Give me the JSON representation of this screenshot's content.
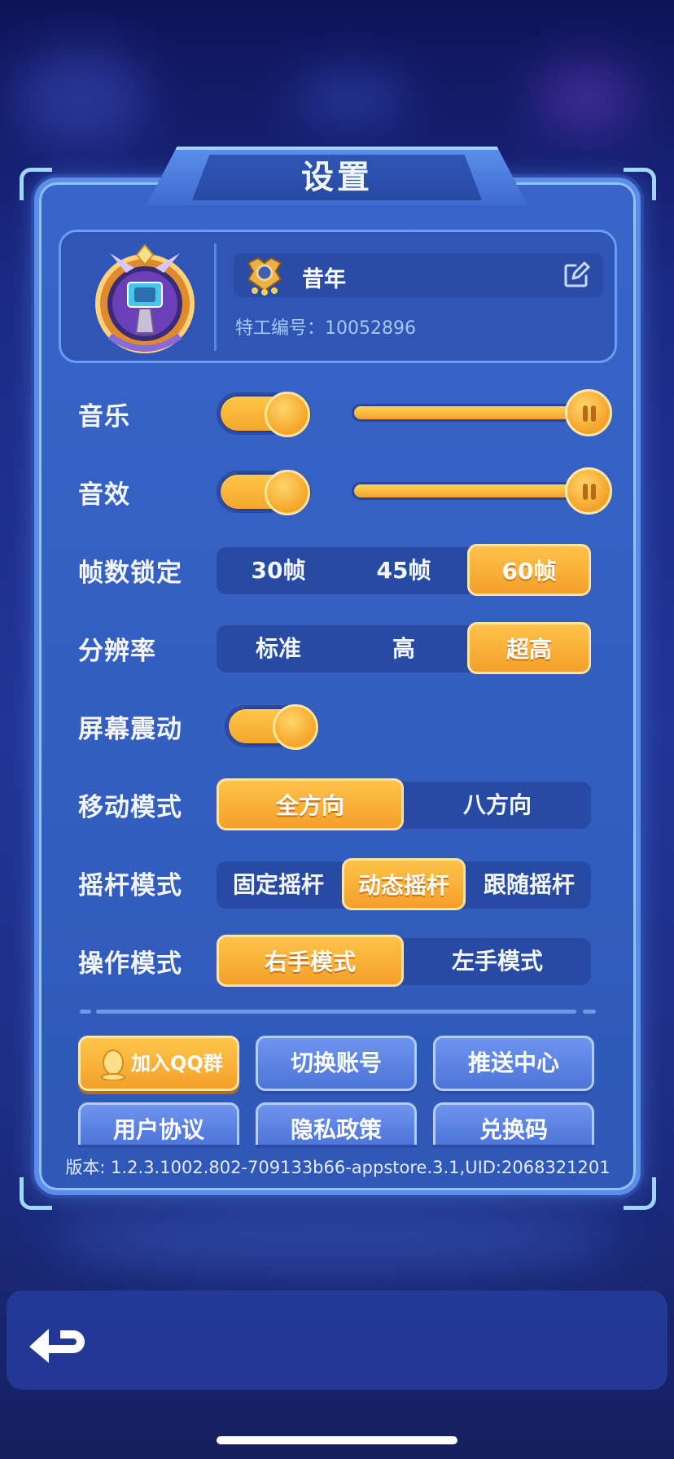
{
  "title": "设置",
  "profile": {
    "player_name": "昔年",
    "agent_id_label": "特工编号：",
    "agent_id": "10052896"
  },
  "settings": {
    "music": {
      "label": "音乐",
      "enabled": true,
      "volume": 1.0
    },
    "sfx": {
      "label": "音效",
      "enabled": true,
      "volume": 1.0
    },
    "fps_lock": {
      "label": "帧数锁定",
      "options": [
        "30帧",
        "45帧",
        "60帧"
      ],
      "selected": "60帧"
    },
    "resolution": {
      "label": "分辨率",
      "options": [
        "标准",
        "高",
        "超高"
      ],
      "selected": "超高"
    },
    "screen_shake": {
      "label": "屏幕震动",
      "enabled": true
    },
    "move_mode": {
      "label": "移动模式",
      "options": [
        "全方向",
        "八方向"
      ],
      "selected": "全方向"
    },
    "joystick_mode": {
      "label": "摇杆模式",
      "options": [
        "固定摇杆",
        "动态摇杆",
        "跟随摇杆"
      ],
      "selected": "动态摇杆"
    },
    "control_mode": {
      "label": "操作模式",
      "options": [
        "右手模式",
        "左手模式"
      ],
      "selected": "右手模式"
    }
  },
  "buttons": {
    "join_qq": "加入QQ群",
    "switch_account": "切换账号",
    "push_center": "推送中心",
    "user_agreement": "用户协议",
    "privacy_policy": "隐私政策",
    "redeem_code": "兑换码"
  },
  "version_text": "版本: 1.2.3.1002.802-709133b66-appstore.3.1,UID:2068321201",
  "colors": {
    "accent": "#f3a02a",
    "panel": "#3560c2",
    "dark_segment": "#274aa2"
  },
  "icons": [
    "avatar-emblem-icon",
    "rank-badge-icon",
    "edit-icon",
    "qq-penguin-icon",
    "back-arrow-icon"
  ]
}
